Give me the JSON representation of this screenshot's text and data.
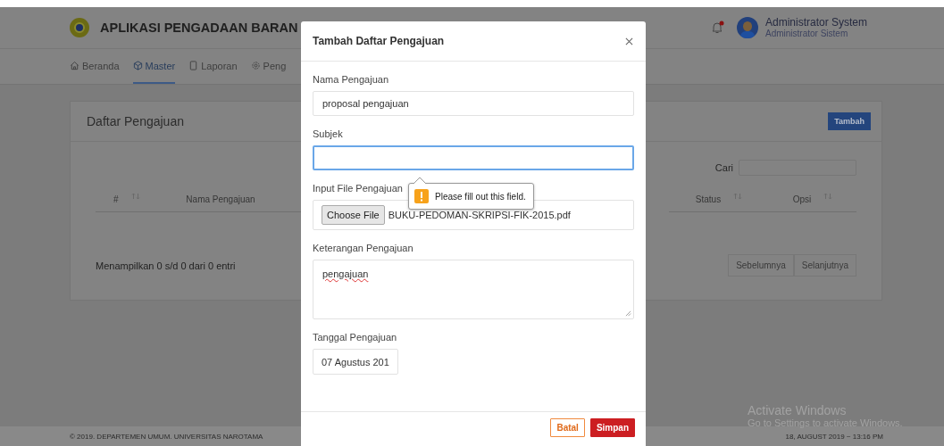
{
  "header": {
    "app_title": "APLIKASI PENGADAAN BARAN",
    "notification": {
      "unread": true
    },
    "user_name": "Administrator System",
    "user_role": "Administrator Sistem"
  },
  "nav": [
    {
      "label": "Beranda",
      "kind": "home",
      "selected": false
    },
    {
      "label": "Master",
      "kind": "cube",
      "selected": true
    },
    {
      "label": "Laporan",
      "kind": "doc",
      "selected": false
    },
    {
      "label": "Peng",
      "kind": "gear",
      "selected": false
    }
  ],
  "card": {
    "title": "Daftar Pengajuan",
    "add_button": "Tambah",
    "search_label": "Cari",
    "columns": [
      {
        "label": "#",
        "sortable": true
      },
      {
        "label": "Nama Pengajuan",
        "sortable": false
      },
      {
        "label": "Status",
        "sortable": true
      },
      {
        "label": "Opsi",
        "sortable": true
      }
    ],
    "info": "Menampilkan 0 s/d 0 dari 0 entri",
    "pagination": [
      "Sebelumnya",
      "Selanjutnya"
    ]
  },
  "footer": {
    "copyright": "© 2019. DEPARTEMEN UMUM. UNIVERSITAS NAROTAMA",
    "datetime": "18, AUGUST 2019 ~ 13:16 PM"
  },
  "os_notice": {
    "title": "Activate Windows",
    "subtitle": "Go to Settings to activate Windows."
  },
  "modal": {
    "title": "Tambah Daftar Pengajuan",
    "fields": [
      {
        "kind": "text",
        "label": "Nama Pengajuan",
        "value": "proposal pengajuan",
        "focused": false
      },
      {
        "kind": "text",
        "label": "Subjek",
        "focused": true
      },
      {
        "kind": "file",
        "label": "Input File Pengajuan",
        "button": "Choose File",
        "file_name": "BUKU-PEDOMAN-SKRIPSI-FIK-2015.pdf"
      },
      {
        "kind": "textarea",
        "label": "Keterangan Pengajuan",
        "value": "pengajuan"
      },
      {
        "kind": "date",
        "label": "Tanggal Pengajuan",
        "value": "07 Agustus 201"
      }
    ],
    "validation_tooltip": {
      "message": "Please fill out this field."
    },
    "buttons": [
      {
        "kind": "cancel",
        "label": "Batal"
      },
      {
        "kind": "save",
        "label": "Simpan"
      }
    ]
  }
}
